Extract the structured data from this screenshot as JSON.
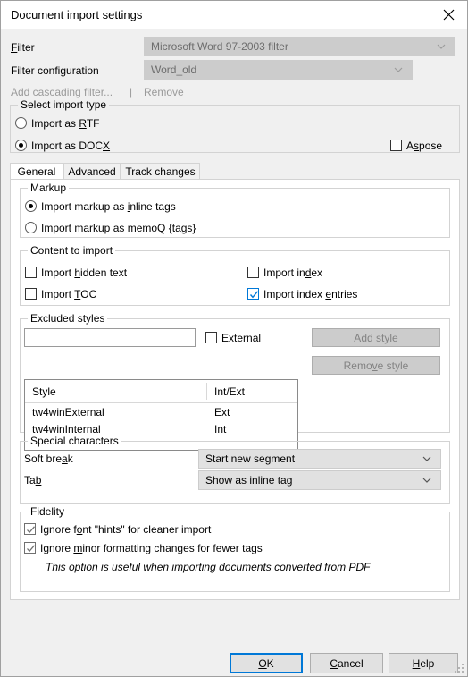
{
  "window": {
    "title": "Document import settings",
    "close_icon": "close-icon"
  },
  "filter_section": {
    "filter_label": "Filter",
    "filter_label_accel": "F",
    "filter_value": "Microsoft Word 97-2003 filter",
    "filter_config_label": "Filter configuration",
    "filter_config_value": "Word_old",
    "add_cascading_filter_label": "Add cascading filter...",
    "separator": "|",
    "remove_label": "Remove"
  },
  "import_type": {
    "group_title": "Select import type",
    "options": [
      {
        "label": "Import as RTF",
        "selected": false
      },
      {
        "label": "Import as DOCX",
        "selected": true
      }
    ],
    "aspose": {
      "label": "Aspose",
      "checked": false
    }
  },
  "tabs": [
    {
      "label": "General",
      "active": true
    },
    {
      "label": "Advanced",
      "active": false
    },
    {
      "label": "Track changes",
      "active": false
    }
  ],
  "markup": {
    "group_title": "Markup",
    "options": [
      {
        "label": "Import markup as inline tags",
        "selected": true
      },
      {
        "label": "Import markup as memoQ {tags}",
        "selected": false
      }
    ]
  },
  "content_to_import": {
    "group_title": "Content to import",
    "items": [
      {
        "label": "Import hidden text",
        "checked": false,
        "style": "plain"
      },
      {
        "label": "Import index",
        "checked": false,
        "style": "plain"
      },
      {
        "label": "Import TOC",
        "checked": false,
        "style": "plain"
      },
      {
        "label": "Import index entries",
        "checked": true,
        "style": "blue"
      }
    ]
  },
  "excluded_styles": {
    "group_title": "Excluded styles",
    "input_value": "",
    "external_label": "External",
    "external_checked": false,
    "add_style_label": "Add style",
    "remove_style_label": "Remove style",
    "columns": [
      "Style",
      "Int/Ext"
    ],
    "rows": [
      [
        "tw4winExternal",
        "Ext"
      ],
      [
        "tw4winInternal",
        "Int"
      ]
    ]
  },
  "special_characters": {
    "group_title": "Special characters",
    "soft_break_label": "Soft break",
    "soft_break_value": "Start new segment",
    "tab_label": "Tab",
    "tab_value": "Show as inline tag"
  },
  "fidelity": {
    "group_title": "Fidelity",
    "items": [
      {
        "label": "Ignore font \"hints\" for cleaner import",
        "checked": true
      },
      {
        "label": "Ignore minor formatting changes for fewer tags",
        "checked": true
      }
    ],
    "note": "This option is useful when importing documents converted from PDF"
  },
  "footer": {
    "ok_label": "OK",
    "cancel_label": "Cancel",
    "help_label": "Help"
  },
  "colors": {
    "accent": "#0078d7",
    "dialog_bg": "#f0f0f0",
    "panel_bg": "#ffffff",
    "disabled_text": "#838383"
  }
}
